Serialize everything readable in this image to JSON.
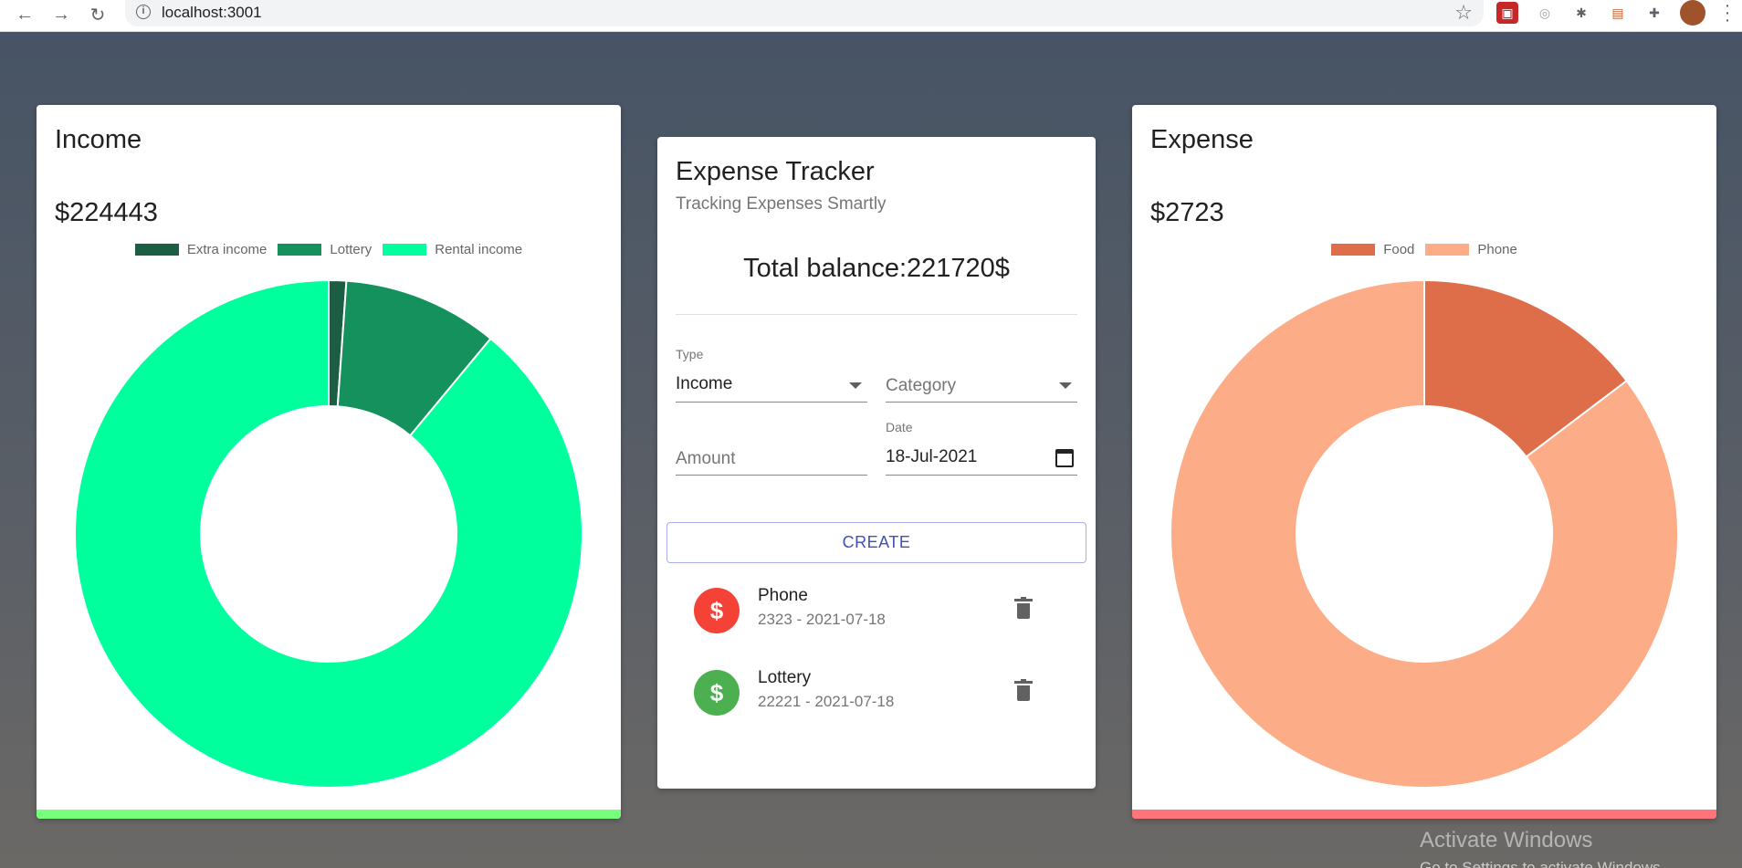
{
  "browser": {
    "url": "localhost:3001",
    "back_icon": "arrow-left-icon",
    "forward_icon": "arrow-right-icon",
    "reload_icon": "reload-icon",
    "star_icon": "star-icon"
  },
  "income": {
    "title": "Income",
    "amount": "$224443",
    "accent_color": "#76ff7a",
    "legend": [
      {
        "label": "Extra income",
        "color": "#1b5e44"
      },
      {
        "label": "Lottery",
        "color": "#14915c"
      },
      {
        "label": "Rental income",
        "color": "#00ff9d"
      }
    ]
  },
  "expense": {
    "title": "Expense",
    "amount": "$2723",
    "accent_color": "#ff7478",
    "legend": [
      {
        "label": "Food",
        "color": "#de6d4a"
      },
      {
        "label": "Phone",
        "color": "#fcad88"
      }
    ]
  },
  "tracker": {
    "title": "Expense Tracker",
    "subtitle": "Tracking Expenses Smartly",
    "balance": "Total balance:221720$",
    "form": {
      "type_label": "Type",
      "type_value": "Income",
      "category_placeholder": "Category",
      "amount_placeholder": "Amount",
      "date_label": "Date",
      "date_value": "18-Jul-2021",
      "create_label": "CREATE"
    },
    "transactions": [
      {
        "name": "Phone",
        "detail": "2323 - 2021-07-18",
        "kind": "expense",
        "color": "#f44336",
        "icon": "money-off-icon"
      },
      {
        "name": "Lottery",
        "detail": "22221 - 2021-07-18",
        "kind": "income",
        "color": "#4caf50",
        "icon": "money-off-icon"
      }
    ]
  },
  "watermark": {
    "line1": "Activate Windows",
    "line2": "Go to Settings to activate Windows."
  },
  "chart_data": [
    {
      "type": "pie",
      "variant": "doughnut",
      "title": "Income",
      "categories": [
        "Extra income",
        "Lottery",
        "Rental income"
      ],
      "values": [
        2500,
        22221,
        199722
      ],
      "colors": [
        "#1b5e44",
        "#14915c",
        "#00ff9d"
      ],
      "legend": "top"
    },
    {
      "type": "pie",
      "variant": "doughnut",
      "title": "Expense",
      "categories": [
        "Food",
        "Phone"
      ],
      "values": [
        400,
        2323
      ],
      "colors": [
        "#de6d4a",
        "#fcad88"
      ],
      "legend": "top"
    }
  ]
}
